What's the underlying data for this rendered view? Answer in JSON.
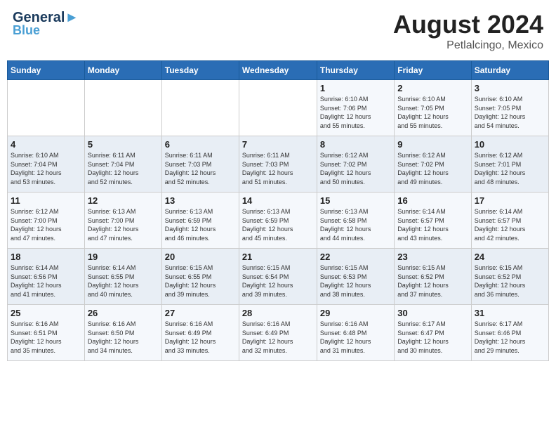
{
  "header": {
    "logo_general": "General",
    "logo_blue": "Blue",
    "month_year": "August 2024",
    "location": "Petlalcingo, Mexico"
  },
  "weekdays": [
    "Sunday",
    "Monday",
    "Tuesday",
    "Wednesday",
    "Thursday",
    "Friday",
    "Saturday"
  ],
  "weeks": [
    [
      {
        "day": "",
        "info": ""
      },
      {
        "day": "",
        "info": ""
      },
      {
        "day": "",
        "info": ""
      },
      {
        "day": "",
        "info": ""
      },
      {
        "day": "1",
        "info": "Sunrise: 6:10 AM\nSunset: 7:06 PM\nDaylight: 12 hours\nand 55 minutes."
      },
      {
        "day": "2",
        "info": "Sunrise: 6:10 AM\nSunset: 7:05 PM\nDaylight: 12 hours\nand 55 minutes."
      },
      {
        "day": "3",
        "info": "Sunrise: 6:10 AM\nSunset: 7:05 PM\nDaylight: 12 hours\nand 54 minutes."
      }
    ],
    [
      {
        "day": "4",
        "info": "Sunrise: 6:10 AM\nSunset: 7:04 PM\nDaylight: 12 hours\nand 53 minutes."
      },
      {
        "day": "5",
        "info": "Sunrise: 6:11 AM\nSunset: 7:04 PM\nDaylight: 12 hours\nand 52 minutes."
      },
      {
        "day": "6",
        "info": "Sunrise: 6:11 AM\nSunset: 7:03 PM\nDaylight: 12 hours\nand 52 minutes."
      },
      {
        "day": "7",
        "info": "Sunrise: 6:11 AM\nSunset: 7:03 PM\nDaylight: 12 hours\nand 51 minutes."
      },
      {
        "day": "8",
        "info": "Sunrise: 6:12 AM\nSunset: 7:02 PM\nDaylight: 12 hours\nand 50 minutes."
      },
      {
        "day": "9",
        "info": "Sunrise: 6:12 AM\nSunset: 7:02 PM\nDaylight: 12 hours\nand 49 minutes."
      },
      {
        "day": "10",
        "info": "Sunrise: 6:12 AM\nSunset: 7:01 PM\nDaylight: 12 hours\nand 48 minutes."
      }
    ],
    [
      {
        "day": "11",
        "info": "Sunrise: 6:12 AM\nSunset: 7:00 PM\nDaylight: 12 hours\nand 47 minutes."
      },
      {
        "day": "12",
        "info": "Sunrise: 6:13 AM\nSunset: 7:00 PM\nDaylight: 12 hours\nand 47 minutes."
      },
      {
        "day": "13",
        "info": "Sunrise: 6:13 AM\nSunset: 6:59 PM\nDaylight: 12 hours\nand 46 minutes."
      },
      {
        "day": "14",
        "info": "Sunrise: 6:13 AM\nSunset: 6:59 PM\nDaylight: 12 hours\nand 45 minutes."
      },
      {
        "day": "15",
        "info": "Sunrise: 6:13 AM\nSunset: 6:58 PM\nDaylight: 12 hours\nand 44 minutes."
      },
      {
        "day": "16",
        "info": "Sunrise: 6:14 AM\nSunset: 6:57 PM\nDaylight: 12 hours\nand 43 minutes."
      },
      {
        "day": "17",
        "info": "Sunrise: 6:14 AM\nSunset: 6:57 PM\nDaylight: 12 hours\nand 42 minutes."
      }
    ],
    [
      {
        "day": "18",
        "info": "Sunrise: 6:14 AM\nSunset: 6:56 PM\nDaylight: 12 hours\nand 41 minutes."
      },
      {
        "day": "19",
        "info": "Sunrise: 6:14 AM\nSunset: 6:55 PM\nDaylight: 12 hours\nand 40 minutes."
      },
      {
        "day": "20",
        "info": "Sunrise: 6:15 AM\nSunset: 6:55 PM\nDaylight: 12 hours\nand 39 minutes."
      },
      {
        "day": "21",
        "info": "Sunrise: 6:15 AM\nSunset: 6:54 PM\nDaylight: 12 hours\nand 39 minutes."
      },
      {
        "day": "22",
        "info": "Sunrise: 6:15 AM\nSunset: 6:53 PM\nDaylight: 12 hours\nand 38 minutes."
      },
      {
        "day": "23",
        "info": "Sunrise: 6:15 AM\nSunset: 6:52 PM\nDaylight: 12 hours\nand 37 minutes."
      },
      {
        "day": "24",
        "info": "Sunrise: 6:15 AM\nSunset: 6:52 PM\nDaylight: 12 hours\nand 36 minutes."
      }
    ],
    [
      {
        "day": "25",
        "info": "Sunrise: 6:16 AM\nSunset: 6:51 PM\nDaylight: 12 hours\nand 35 minutes."
      },
      {
        "day": "26",
        "info": "Sunrise: 6:16 AM\nSunset: 6:50 PM\nDaylight: 12 hours\nand 34 minutes."
      },
      {
        "day": "27",
        "info": "Sunrise: 6:16 AM\nSunset: 6:49 PM\nDaylight: 12 hours\nand 33 minutes."
      },
      {
        "day": "28",
        "info": "Sunrise: 6:16 AM\nSunset: 6:49 PM\nDaylight: 12 hours\nand 32 minutes."
      },
      {
        "day": "29",
        "info": "Sunrise: 6:16 AM\nSunset: 6:48 PM\nDaylight: 12 hours\nand 31 minutes."
      },
      {
        "day": "30",
        "info": "Sunrise: 6:17 AM\nSunset: 6:47 PM\nDaylight: 12 hours\nand 30 minutes."
      },
      {
        "day": "31",
        "info": "Sunrise: 6:17 AM\nSunset: 6:46 PM\nDaylight: 12 hours\nand 29 minutes."
      }
    ]
  ]
}
